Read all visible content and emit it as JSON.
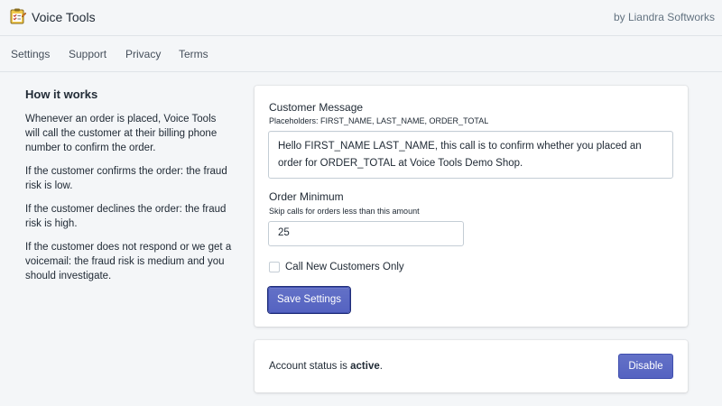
{
  "app": {
    "title": "Voice Tools",
    "by_line": "by Liandra Softworks",
    "icon": "checklist-clipboard-icon"
  },
  "nav": {
    "items": [
      {
        "label": "Settings"
      },
      {
        "label": "Support"
      },
      {
        "label": "Privacy"
      },
      {
        "label": "Terms"
      }
    ]
  },
  "sidebar": {
    "heading": "How it works",
    "paragraphs": [
      "Whenever an order is placed, Voice Tools will call the customer at their billing phone number to confirm the order.",
      "If the customer confirms the order: the fraud risk is low.",
      "If the customer declines the order: the fraud risk is high.",
      "If the customer does not respond or we get a voicemail: the fraud risk is medium and you should investigate."
    ]
  },
  "settings": {
    "message_label": "Customer Message",
    "message_help": "Placeholders: FIRST_NAME, LAST_NAME, ORDER_TOTAL",
    "message_value": "Hello FIRST_NAME LAST_NAME, this call is to confirm whether you placed an order for ORDER_TOTAL at Voice Tools Demo Shop.",
    "minimum_label": "Order Minimum",
    "minimum_help": "Skip calls for orders less than this amount",
    "minimum_value": "25",
    "new_customers_label": "Call New Customers Only",
    "new_customers_checked": false,
    "save_label": "Save Settings"
  },
  "status": {
    "prefix": "Account status is ",
    "value": "active",
    "suffix": ".",
    "disable_label": "Disable"
  },
  "colors": {
    "primary": "#5c6ac4",
    "background": "#f4f6f8",
    "text": "#212b36"
  }
}
